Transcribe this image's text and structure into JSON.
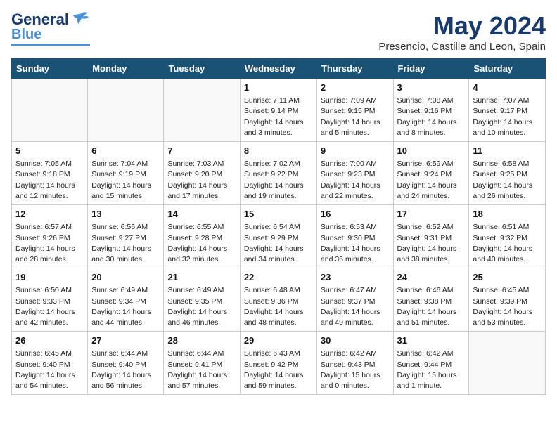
{
  "logo": {
    "line1": "General",
    "line2": "Blue"
  },
  "title": "May 2024",
  "location": "Presencio, Castille and Leon, Spain",
  "weekdays": [
    "Sunday",
    "Monday",
    "Tuesday",
    "Wednesday",
    "Thursday",
    "Friday",
    "Saturday"
  ],
  "weeks": [
    [
      {
        "day": "",
        "info": ""
      },
      {
        "day": "",
        "info": ""
      },
      {
        "day": "",
        "info": ""
      },
      {
        "day": "1",
        "info": "Sunrise: 7:11 AM\nSunset: 9:14 PM\nDaylight: 14 hours and 3 minutes."
      },
      {
        "day": "2",
        "info": "Sunrise: 7:09 AM\nSunset: 9:15 PM\nDaylight: 14 hours and 5 minutes."
      },
      {
        "day": "3",
        "info": "Sunrise: 7:08 AM\nSunset: 9:16 PM\nDaylight: 14 hours and 8 minutes."
      },
      {
        "day": "4",
        "info": "Sunrise: 7:07 AM\nSunset: 9:17 PM\nDaylight: 14 hours and 10 minutes."
      }
    ],
    [
      {
        "day": "5",
        "info": "Sunrise: 7:05 AM\nSunset: 9:18 PM\nDaylight: 14 hours and 12 minutes."
      },
      {
        "day": "6",
        "info": "Sunrise: 7:04 AM\nSunset: 9:19 PM\nDaylight: 14 hours and 15 minutes."
      },
      {
        "day": "7",
        "info": "Sunrise: 7:03 AM\nSunset: 9:20 PM\nDaylight: 14 hours and 17 minutes."
      },
      {
        "day": "8",
        "info": "Sunrise: 7:02 AM\nSunset: 9:22 PM\nDaylight: 14 hours and 19 minutes."
      },
      {
        "day": "9",
        "info": "Sunrise: 7:00 AM\nSunset: 9:23 PM\nDaylight: 14 hours and 22 minutes."
      },
      {
        "day": "10",
        "info": "Sunrise: 6:59 AM\nSunset: 9:24 PM\nDaylight: 14 hours and 24 minutes."
      },
      {
        "day": "11",
        "info": "Sunrise: 6:58 AM\nSunset: 9:25 PM\nDaylight: 14 hours and 26 minutes."
      }
    ],
    [
      {
        "day": "12",
        "info": "Sunrise: 6:57 AM\nSunset: 9:26 PM\nDaylight: 14 hours and 28 minutes."
      },
      {
        "day": "13",
        "info": "Sunrise: 6:56 AM\nSunset: 9:27 PM\nDaylight: 14 hours and 30 minutes."
      },
      {
        "day": "14",
        "info": "Sunrise: 6:55 AM\nSunset: 9:28 PM\nDaylight: 14 hours and 32 minutes."
      },
      {
        "day": "15",
        "info": "Sunrise: 6:54 AM\nSunset: 9:29 PM\nDaylight: 14 hours and 34 minutes."
      },
      {
        "day": "16",
        "info": "Sunrise: 6:53 AM\nSunset: 9:30 PM\nDaylight: 14 hours and 36 minutes."
      },
      {
        "day": "17",
        "info": "Sunrise: 6:52 AM\nSunset: 9:31 PM\nDaylight: 14 hours and 38 minutes."
      },
      {
        "day": "18",
        "info": "Sunrise: 6:51 AM\nSunset: 9:32 PM\nDaylight: 14 hours and 40 minutes."
      }
    ],
    [
      {
        "day": "19",
        "info": "Sunrise: 6:50 AM\nSunset: 9:33 PM\nDaylight: 14 hours and 42 minutes."
      },
      {
        "day": "20",
        "info": "Sunrise: 6:49 AM\nSunset: 9:34 PM\nDaylight: 14 hours and 44 minutes."
      },
      {
        "day": "21",
        "info": "Sunrise: 6:49 AM\nSunset: 9:35 PM\nDaylight: 14 hours and 46 minutes."
      },
      {
        "day": "22",
        "info": "Sunrise: 6:48 AM\nSunset: 9:36 PM\nDaylight: 14 hours and 48 minutes."
      },
      {
        "day": "23",
        "info": "Sunrise: 6:47 AM\nSunset: 9:37 PM\nDaylight: 14 hours and 49 minutes."
      },
      {
        "day": "24",
        "info": "Sunrise: 6:46 AM\nSunset: 9:38 PM\nDaylight: 14 hours and 51 minutes."
      },
      {
        "day": "25",
        "info": "Sunrise: 6:45 AM\nSunset: 9:39 PM\nDaylight: 14 hours and 53 minutes."
      }
    ],
    [
      {
        "day": "26",
        "info": "Sunrise: 6:45 AM\nSunset: 9:40 PM\nDaylight: 14 hours and 54 minutes."
      },
      {
        "day": "27",
        "info": "Sunrise: 6:44 AM\nSunset: 9:40 PM\nDaylight: 14 hours and 56 minutes."
      },
      {
        "day": "28",
        "info": "Sunrise: 6:44 AM\nSunset: 9:41 PM\nDaylight: 14 hours and 57 minutes."
      },
      {
        "day": "29",
        "info": "Sunrise: 6:43 AM\nSunset: 9:42 PM\nDaylight: 14 hours and 59 minutes."
      },
      {
        "day": "30",
        "info": "Sunrise: 6:42 AM\nSunset: 9:43 PM\nDaylight: 15 hours and 0 minutes."
      },
      {
        "day": "31",
        "info": "Sunrise: 6:42 AM\nSunset: 9:44 PM\nDaylight: 15 hours and 1 minute."
      },
      {
        "day": "",
        "info": ""
      }
    ]
  ]
}
